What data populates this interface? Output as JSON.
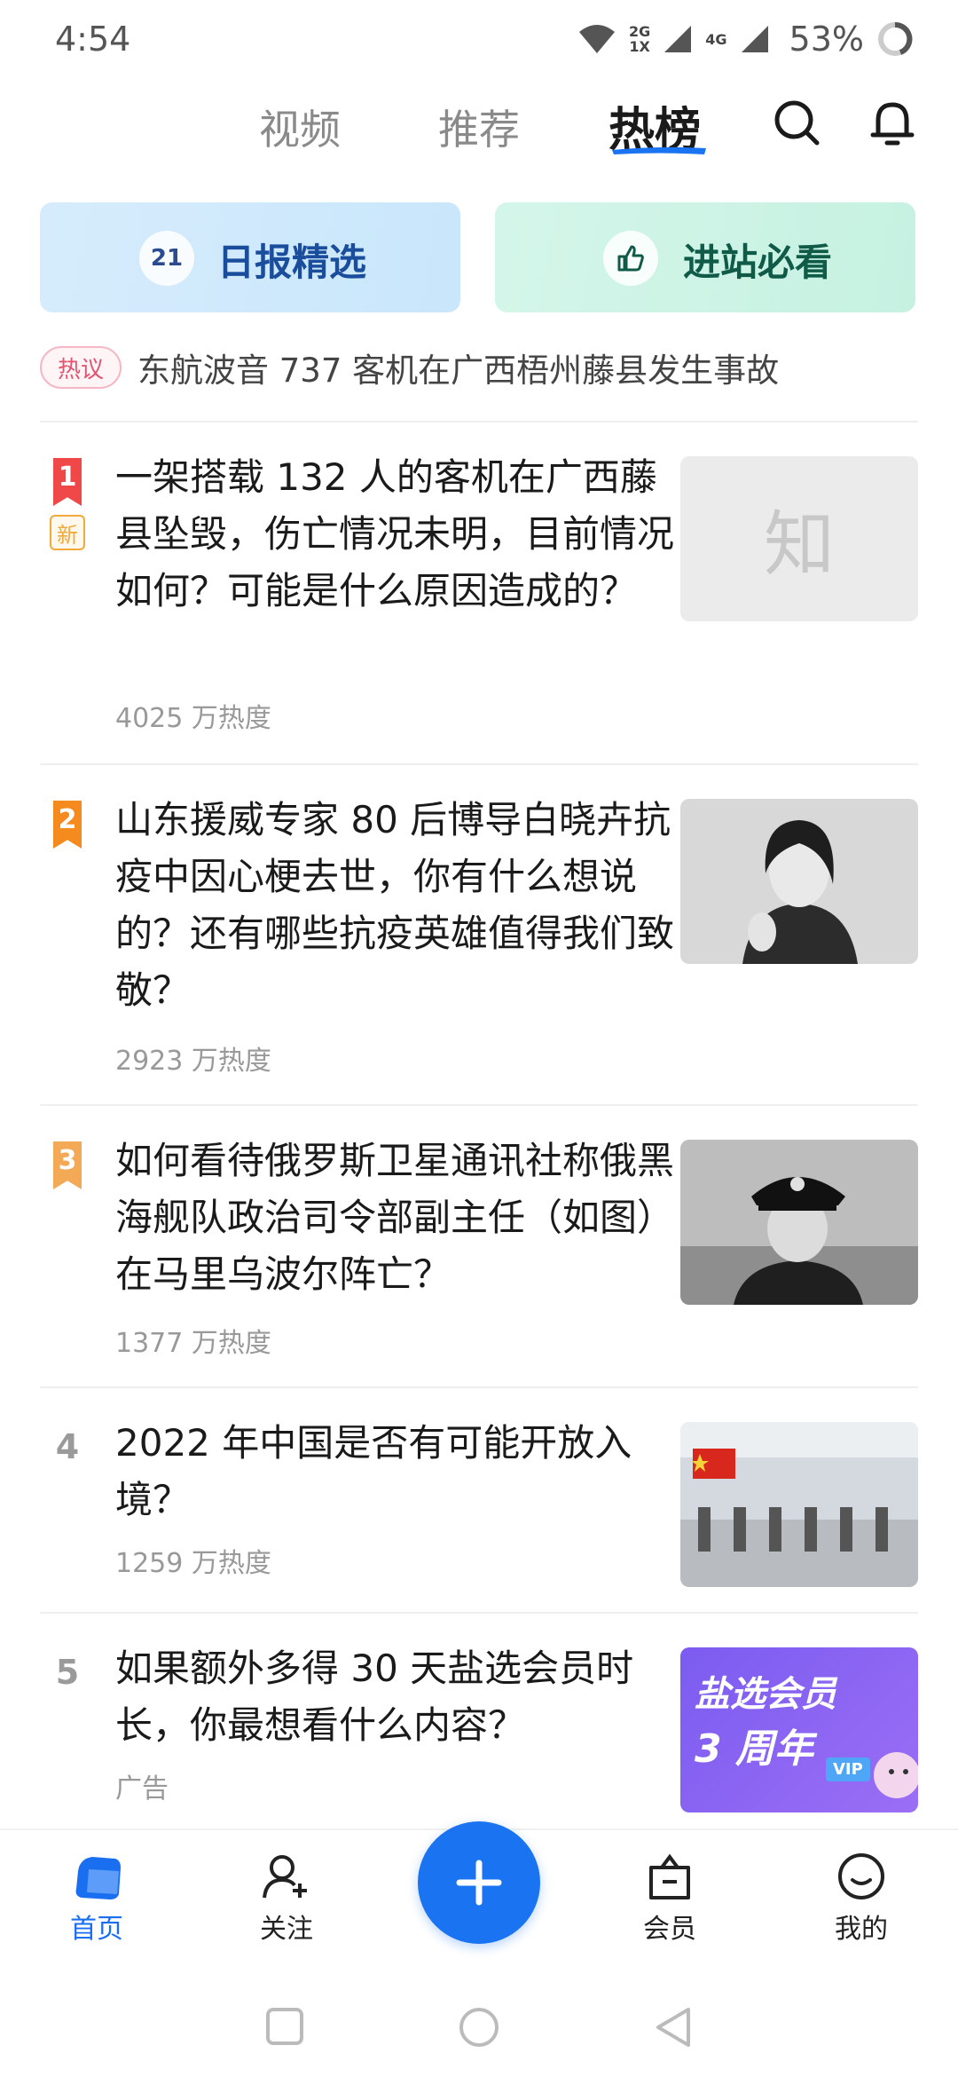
{
  "status_bar": {
    "time": "4:54",
    "net_top": "2G",
    "net_bottom": "1X",
    "net_4g": "4G",
    "battery": "53%"
  },
  "top_nav": {
    "tabs": [
      {
        "label": "视频"
      },
      {
        "label": "推荐"
      },
      {
        "label": "热榜"
      }
    ],
    "active_tab": "热榜",
    "accent_color": "#1a73f0"
  },
  "quick_cards": [
    {
      "badge": "21",
      "label": "日报精选"
    },
    {
      "label": "进站必看"
    }
  ],
  "discussion": {
    "tag": "热议",
    "text": "东航波音 737 客机在广西梧州藤县发生事故"
  },
  "hot_list": [
    {
      "rank": "1",
      "new_tag": "新",
      "title": "一架搭载 132 人的客机在广西藤县坠毁，伤亡情况未明，目前情况如何？可能是什么原因造成的？",
      "heat": "4025 万热度",
      "thumb_text": "知"
    },
    {
      "rank": "2",
      "title": "山东援威专家 80 后博导白晓卉抗疫中因心梗去世，你有什么想说的？还有哪些抗疫英雄值得我们致敬？",
      "heat": "2923 万热度"
    },
    {
      "rank": "3",
      "title": "如何看待俄罗斯卫星通讯社称俄黑海舰队政治司令部副主任（如图）在马里乌波尔阵亡？",
      "heat": "1377 万热度"
    },
    {
      "rank": "4",
      "title": "2022 年中国是否有可能开放入境？",
      "heat": "1259 万热度"
    },
    {
      "rank": "5",
      "title": "如果额外多得 30 天盐选会员时长，你最想看什么内容？",
      "heat": "广告",
      "thumb_line1": "盐选会员",
      "thumb_line2": "3 周年",
      "thumb_vip": "VIP"
    }
  ],
  "bottom_nav": {
    "items": [
      {
        "label": "首页"
      },
      {
        "label": "关注"
      },
      {
        "label": "会员"
      },
      {
        "label": "我的"
      }
    ],
    "active": "首页"
  }
}
